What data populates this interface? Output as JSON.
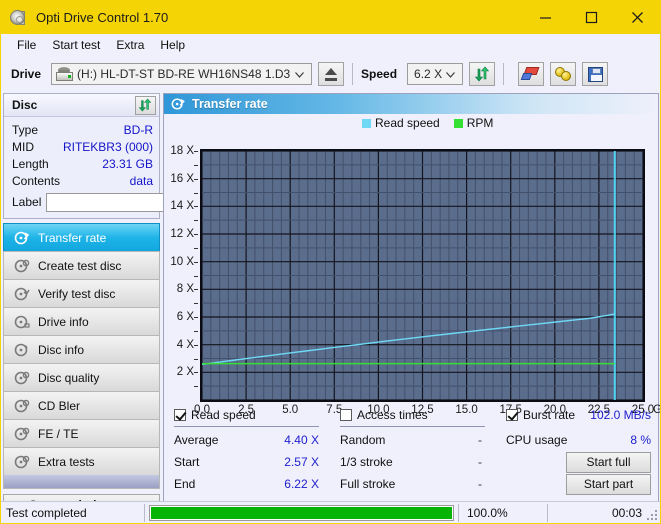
{
  "window": {
    "title": "Opti Drive Control 1.70",
    "icon": "disc-drive-icon",
    "minimize": "–",
    "maximize": "□",
    "close": "✕",
    "accent_color": "#f5d406"
  },
  "menu": {
    "items": [
      {
        "label": "File",
        "name": "menu-file"
      },
      {
        "label": "Start test",
        "name": "menu-start-test"
      },
      {
        "label": "Extra",
        "name": "menu-extra"
      },
      {
        "label": "Help",
        "name": "menu-help"
      }
    ]
  },
  "toolbar": {
    "drive_label": "Drive",
    "drive_value": "(H:)  HL-DT-ST BD-RE  WH16NS48 1.D3",
    "speed_label": "Speed",
    "speed_value": "6.2 X",
    "buttons": [
      {
        "name": "eject-button",
        "icon": "eject-icon"
      },
      {
        "name": "refresh-drive-button",
        "icon": "refresh-icon"
      },
      {
        "name": "erase-button",
        "icon": "eraser-icon"
      },
      {
        "name": "plugin-button",
        "icon": "plug-icon"
      },
      {
        "name": "save-button",
        "icon": "floppy-save-icon"
      }
    ]
  },
  "disc_panel": {
    "title": "Disc",
    "refresh_icon": "refresh-icon",
    "rows": [
      {
        "key": "Type",
        "value": "BD-R"
      },
      {
        "key": "MID",
        "value": "RITEKBR3 (000)"
      },
      {
        "key": "Length",
        "value": "23.31 GB"
      },
      {
        "key": "Contents",
        "value": "data"
      }
    ],
    "label_key": "Label",
    "label_value": "",
    "label_placeholder": "",
    "label_button_icon": "cd-icon"
  },
  "nav": {
    "items": [
      {
        "label": "Transfer rate",
        "icon": "disc-check-icon",
        "active": true
      },
      {
        "label": "Create test disc",
        "icon": "disc-write-icon",
        "active": false
      },
      {
        "label": "Verify test disc",
        "icon": "disc-verify-icon",
        "active": false
      },
      {
        "label": "Drive info",
        "icon": "disc-info-icon",
        "active": false
      },
      {
        "label": "Disc info",
        "icon": "disc-info-icon",
        "active": false
      },
      {
        "label": "Disc quality",
        "icon": "disc-quality-icon",
        "active": false
      },
      {
        "label": "CD Bler",
        "icon": "disc-bler-icon",
        "active": false
      },
      {
        "label": "FE / TE",
        "icon": "disc-fete-icon",
        "active": false
      },
      {
        "label": "Extra tests",
        "icon": "disc-extra-icon",
        "active": false
      }
    ],
    "status_window_label": "Status window > >"
  },
  "main": {
    "title": "Transfer rate",
    "title_icon": "disc-check-icon"
  },
  "chart_data": {
    "type": "line",
    "title": "Transfer rate",
    "xlabel": "GB",
    "ylabel": "X",
    "xlim": [
      0,
      25.0
    ],
    "ylim": [
      0,
      18
    ],
    "grid": true,
    "legend_position": "top-left",
    "x_ticks": [
      "0.0",
      "2.5",
      "5.0",
      "7.5",
      "10.0",
      "12.5",
      "15.0",
      "17.5",
      "20.0",
      "22.5",
      "25.0"
    ],
    "x_tick_values": [
      0,
      2.5,
      5.0,
      7.5,
      10.0,
      12.5,
      15.0,
      17.5,
      20.0,
      22.5,
      25.0
    ],
    "x_unit": "GB",
    "y_ticks": [
      "2 X",
      "4 X",
      "6 X",
      "8 X",
      "10 X",
      "12 X",
      "14 X",
      "16 X",
      "18 X"
    ],
    "y_tick_values": [
      2,
      4,
      6,
      8,
      10,
      12,
      14,
      16,
      18
    ],
    "legend": [
      {
        "name": "Read speed",
        "color": "#6fd8f5"
      },
      {
        "name": "RPM",
        "color": "#35e035"
      }
    ],
    "series": [
      {
        "name": "Read speed",
        "color": "#6fd8f5",
        "x": [
          0.0,
          1.0,
          2.0,
          3.0,
          4.0,
          5.0,
          6.0,
          7.0,
          8.0,
          9.0,
          10.0,
          11.0,
          12.0,
          13.0,
          14.0,
          15.0,
          16.0,
          17.0,
          18.0,
          19.0,
          20.0,
          21.0,
          22.0,
          23.0,
          23.4
        ],
        "y": [
          2.57,
          2.74,
          2.91,
          3.08,
          3.24,
          3.4,
          3.56,
          3.72,
          3.88,
          4.03,
          4.19,
          4.34,
          4.49,
          4.64,
          4.78,
          4.93,
          5.07,
          5.21,
          5.35,
          5.49,
          5.63,
          5.77,
          5.91,
          6.12,
          6.22
        ]
      },
      {
        "name": "RPM",
        "color": "#35e035",
        "x": [
          0.0,
          5.5,
          12.0,
          18.0,
          23.4
        ],
        "y": [
          2.63,
          2.63,
          2.63,
          2.63,
          2.63
        ]
      }
    ],
    "markers": [
      {
        "name": "end-of-data-line",
        "type": "vline",
        "x": 23.4,
        "color": "#4fd2f0"
      }
    ]
  },
  "stats": {
    "read_speed": {
      "checkbox_label": "Read speed",
      "checked": true,
      "rows": [
        {
          "key": "Average",
          "value": "4.40 X"
        },
        {
          "key": "Start",
          "value": "2.57 X"
        },
        {
          "key": "End",
          "value": "6.22 X"
        }
      ]
    },
    "access_times": {
      "checkbox_label": "Access times",
      "checked": false,
      "rows": [
        {
          "key": "Random",
          "value": "-"
        },
        {
          "key": "1/3 stroke",
          "value": "-"
        },
        {
          "key": "Full stroke",
          "value": "-"
        }
      ]
    },
    "burst_rate": {
      "checkbox_label": "Burst rate",
      "checked": true,
      "value": "102.0 MB/s",
      "cpu_key": "CPU usage",
      "cpu_value": "8 %",
      "start_full_label": "Start full",
      "start_part_label": "Start part"
    }
  },
  "statusbar": {
    "text": "Test completed",
    "progress_percent": 100.0,
    "progress_label": "100.0%",
    "elapsed": "00:03",
    "progress_color": "#06b406"
  }
}
